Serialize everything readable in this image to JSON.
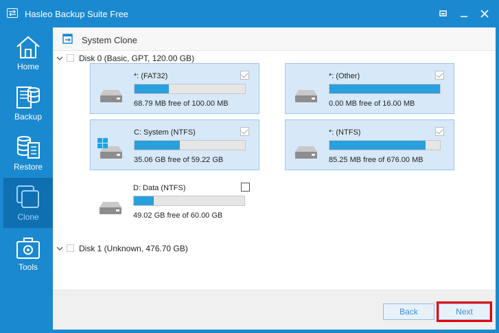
{
  "window": {
    "title": "Hasleo Backup Suite Free",
    "controls": [
      "restore",
      "minimize",
      "close"
    ]
  },
  "sidebar": {
    "items": [
      {
        "label": "Home",
        "icon": "home-icon",
        "active": false
      },
      {
        "label": "Backup",
        "icon": "backup-icon",
        "active": false
      },
      {
        "label": "Restore",
        "icon": "restore-icon",
        "active": false
      },
      {
        "label": "Clone",
        "icon": "clone-icon",
        "active": true
      },
      {
        "label": "Tools",
        "icon": "tools-icon",
        "active": false
      }
    ]
  },
  "header": {
    "title": "System Clone",
    "icon": "system-clone-icon"
  },
  "disks": [
    {
      "label": "Disk 0 (Basic, GPT, 120.00 GB)",
      "expanded": true,
      "checked": false,
      "partitions": [
        {
          "name": "*: (FAT32)",
          "free": "68.79 MB free of 100.00 MB",
          "used_fraction": 0.31,
          "checked": true,
          "selected": true,
          "windows_logo": false
        },
        {
          "name": "*: (Other)",
          "free": "0.00 MB free of 16.00 MB",
          "used_fraction": 1.0,
          "checked": true,
          "selected": true,
          "windows_logo": false
        },
        {
          "name": "C: System (NTFS)",
          "free": "35.06 GB free of 59.22 GB",
          "used_fraction": 0.41,
          "checked": true,
          "selected": true,
          "windows_logo": true
        },
        {
          "name": "*: (NTFS)",
          "free": "85.25 MB free of 676.00 MB",
          "used_fraction": 0.87,
          "checked": true,
          "selected": true,
          "windows_logo": false
        },
        {
          "name": "D: Data (NTFS)",
          "free": "49.02 GB free of 60.00 GB",
          "used_fraction": 0.18,
          "checked": false,
          "selected": false,
          "windows_logo": false
        }
      ]
    },
    {
      "label": "Disk 1 (Unknown, 476.70 GB)",
      "expanded": false,
      "checked": false
    }
  ],
  "footer": {
    "back_label": "Back",
    "next_label": "Next"
  },
  "colors": {
    "accent": "#1b89cf",
    "active_nav": "#0f6fb0",
    "selected_partition": "#d7e9f8",
    "usage_bar": "#2a9fde",
    "highlight": "#e8000b"
  }
}
